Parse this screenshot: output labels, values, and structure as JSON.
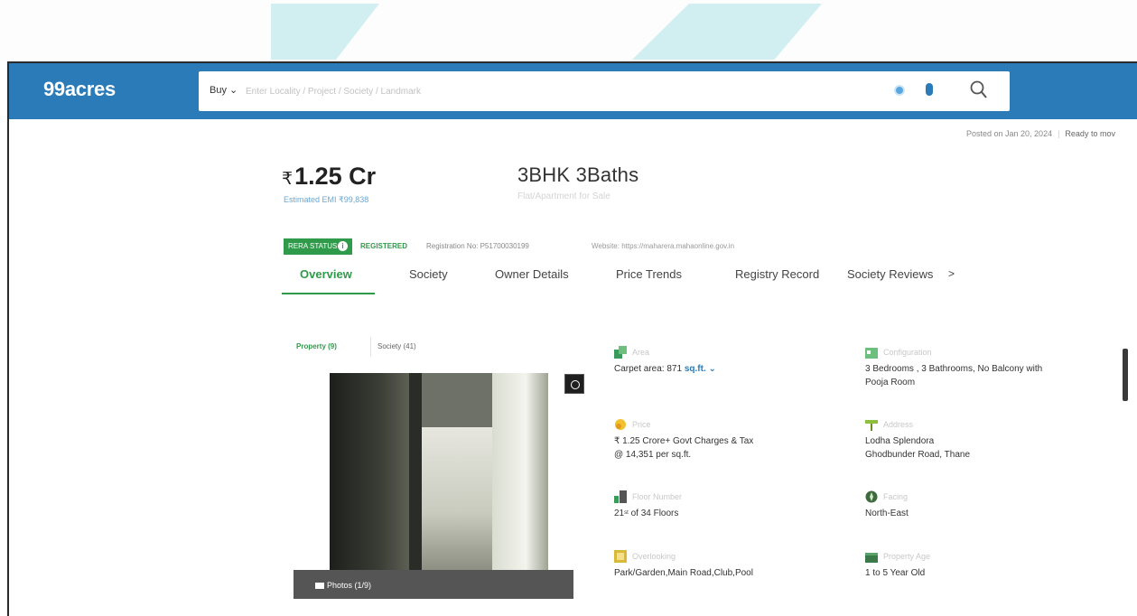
{
  "colors": {
    "header_bg": "#2a7bb7",
    "accent_green": "#2f9a4a",
    "link_blue": "#2a7bb7"
  },
  "header": {
    "logo": "99acres",
    "buy_dropdown": "Buy ⌄",
    "search_placeholder": "Enter Locality / Project / Society / Landmark"
  },
  "listing": {
    "posted": "Posted on Jan 20, 2024",
    "ready": "Ready to mov",
    "price": "1.25 Cr",
    "currency_symbol": "₹",
    "emi": "Estimated EMI ₹99,838",
    "bhk_title": "3BHK 3Baths",
    "flat_type": "Flat/Apartment for Sale"
  },
  "rera": {
    "badge": "RERA STATUS",
    "status": "REGISTERED",
    "registration": "Registration No: P51700030199",
    "website": "Website: https://maharera.mahaonline.gov.in"
  },
  "tabs": [
    "Overview",
    "Society",
    "Owner Details",
    "Price Trends",
    "Registry Record",
    "Society Reviews"
  ],
  "tab_more": ">",
  "photo_panel": {
    "tab_property": "Property (9)",
    "tab_society": "Society (41)",
    "photos_count": "Photos (1/9)"
  },
  "details": {
    "area": {
      "label": "Area",
      "value_prefix": "Carpet area: 871",
      "unit": "sq.ft. ⌄"
    },
    "configuration": {
      "label": "Configuration",
      "line1": "3 Bedrooms , 3 Bathrooms, No Balcony with",
      "line2": "Pooja Room"
    },
    "price": {
      "label": "Price",
      "line1": "₹ 1.25 Crore+ Govt Charges & Tax",
      "line2": "@ 14,351 per sq.ft."
    },
    "address": {
      "label": "Address",
      "line1": "Lodha Splendora",
      "line2": "Ghodbunder Road, Thane"
    },
    "floor": {
      "label": "Floor Number",
      "floor_num": "21",
      "floor_suffix": "st",
      "of_floors": "of 34 Floors"
    },
    "facing": {
      "label": "Facing",
      "value": "North-East"
    },
    "overlooking": {
      "label": "Overlooking",
      "value": "Park/Garden,Main Road,Club,Pool"
    },
    "property_age": {
      "label": "Property Age",
      "value": "1 to 5 Year Old"
    }
  },
  "icons": [
    "search-icon",
    "location-icon",
    "mic-icon",
    "info-icon",
    "camera-icon",
    "expand-icon",
    "area-icon",
    "configuration-icon",
    "price-icon",
    "address-icon",
    "floor-icon",
    "facing-icon",
    "overlooking-icon",
    "property-age-icon"
  ]
}
